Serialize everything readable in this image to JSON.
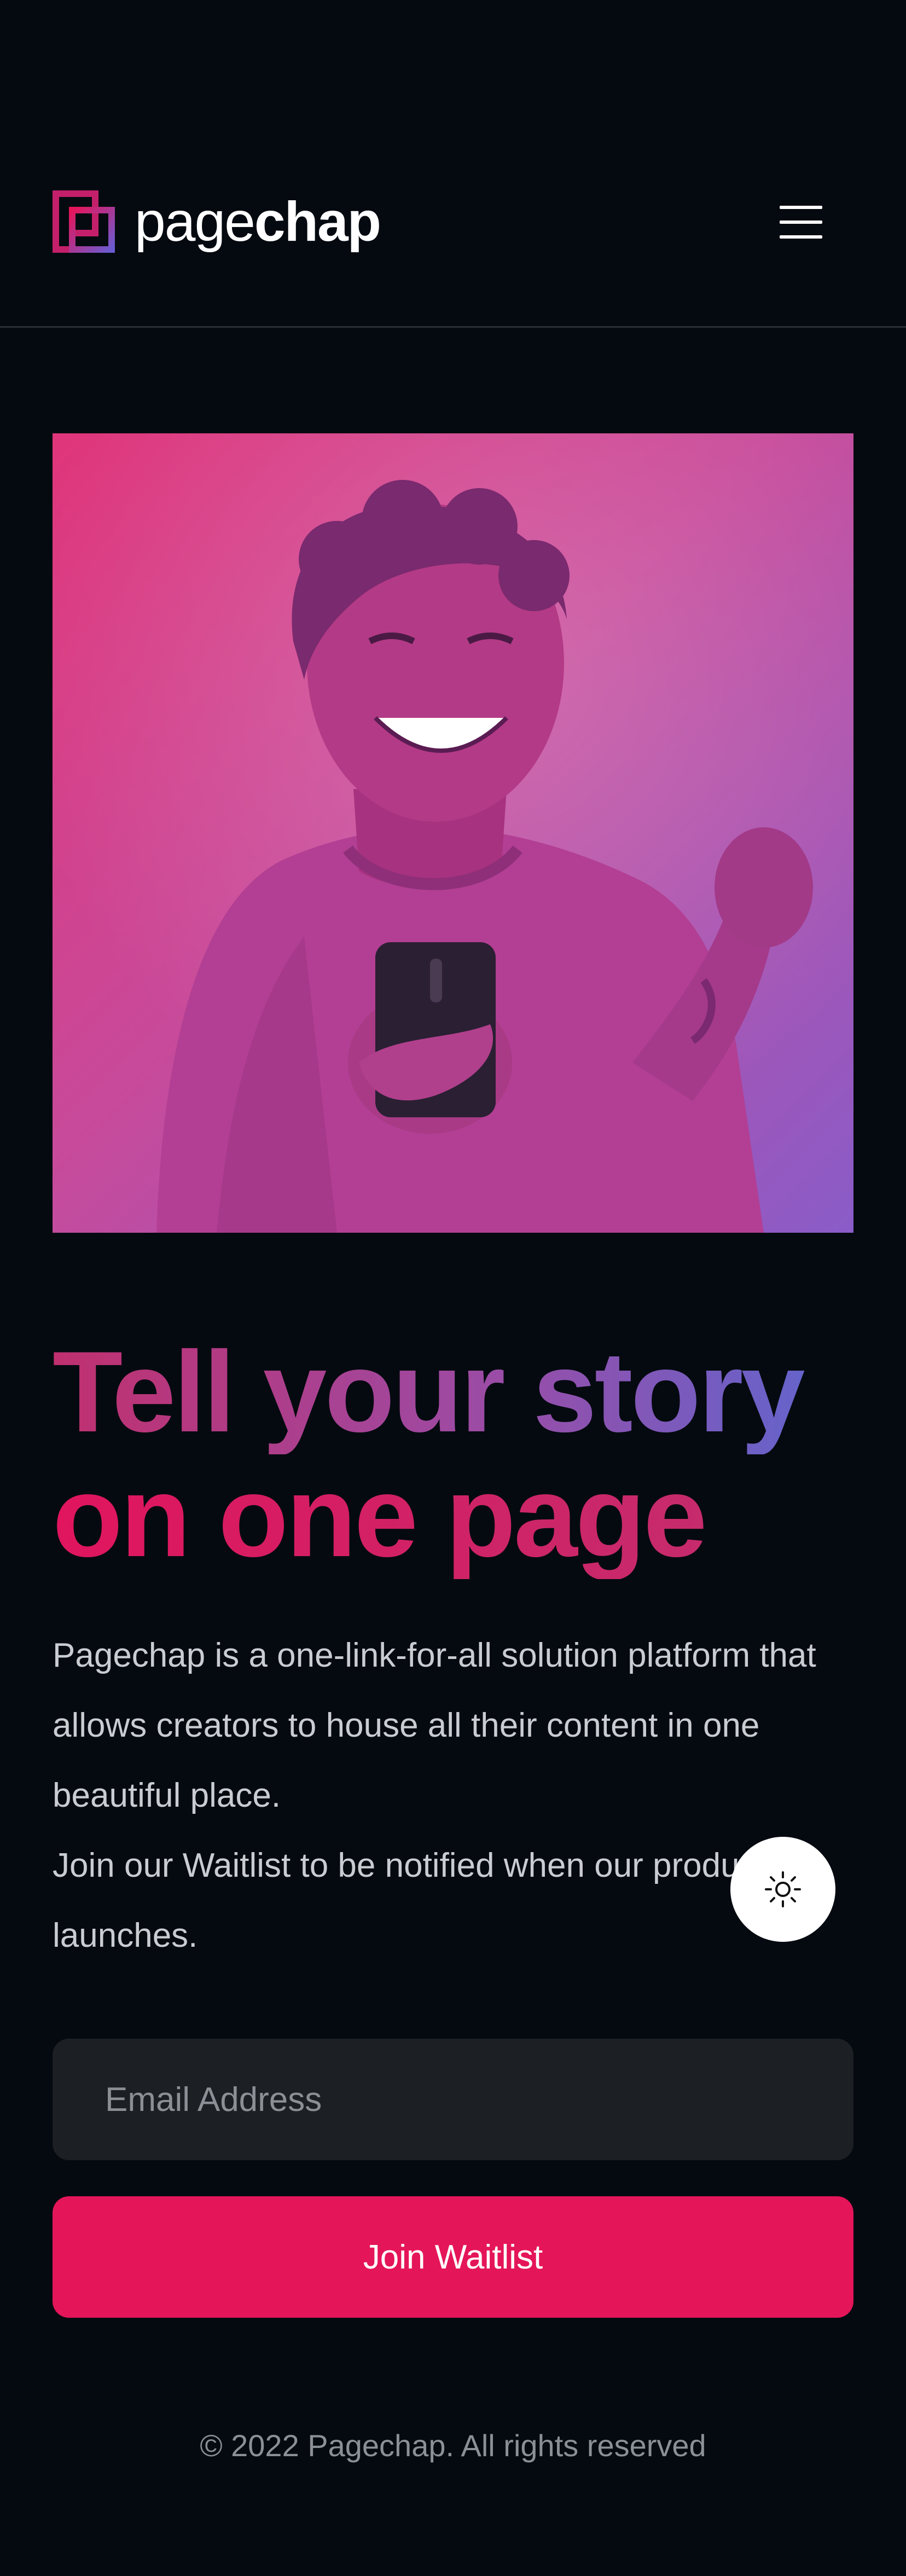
{
  "header": {
    "logo_prefix": "page",
    "logo_suffix": "chap",
    "menu_icon": "hamburger-menu-icon"
  },
  "hero": {
    "image": "smiling-person-holding-phone-photo",
    "tint_colors": [
      "#e0357a",
      "#8a5cc8"
    ]
  },
  "headline": {
    "line1": "Tell your story",
    "line2": "on one page"
  },
  "description": {
    "paragraph1": "Pagechap is a one-link-for-all solution platform that allows creators to house all their content in one beautiful place.",
    "paragraph2": "Join our Waitlist to be notified when our product launches."
  },
  "theme_toggle": {
    "icon": "sun-icon"
  },
  "form": {
    "email_placeholder": "Email Address",
    "email_value": "",
    "submit_label": "Join Waitlist"
  },
  "footer": {
    "copyright": "© 2022 Pagechap. All rights reserved"
  },
  "colors": {
    "background": "#050a10",
    "accent": "#e5155a",
    "input_bg": "#1c2024",
    "gradient_start": "#c0306f",
    "gradient_end": "#5d67d0"
  }
}
